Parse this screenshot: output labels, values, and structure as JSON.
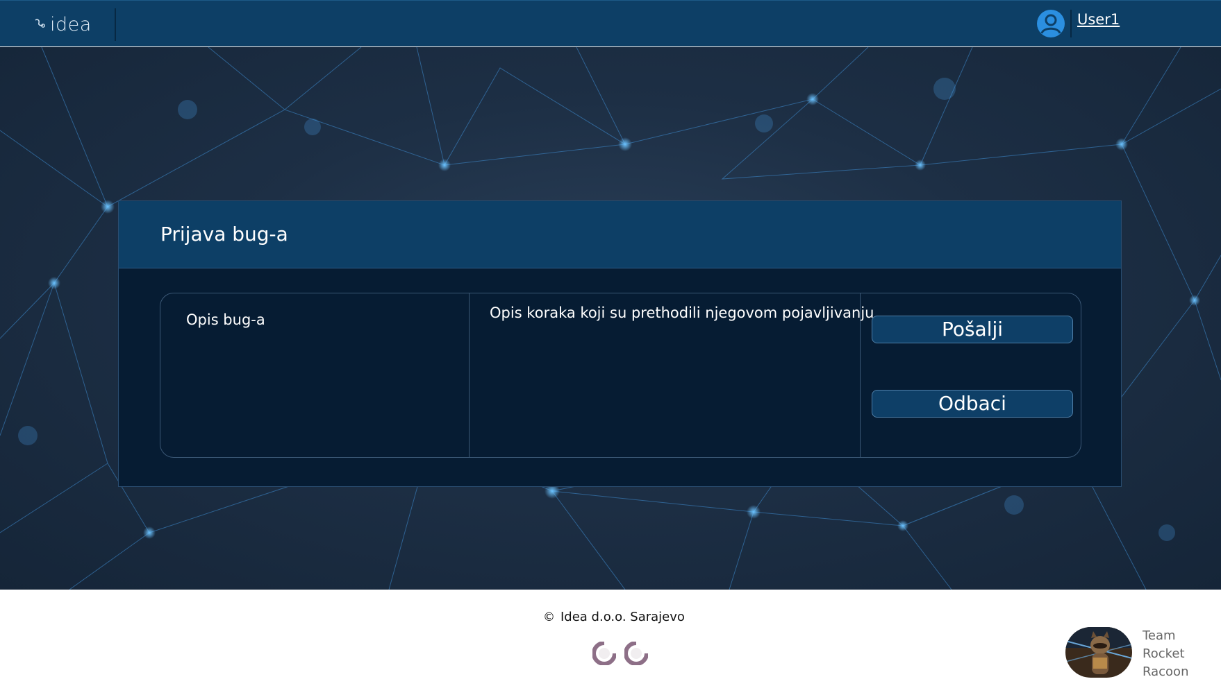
{
  "header": {
    "logo_text": "idea",
    "user_name": "User1"
  },
  "panel": {
    "title": "Prijava bug-a",
    "bug_description_label": "Opis bug-a",
    "steps_label": "Opis koraka koji su prethodili njegovom pojavljivanju",
    "send_button": "Pošalji",
    "discard_button": "Odbaci"
  },
  "footer": {
    "copyright_symbol": "©",
    "copyright_text": "Idea d.o.o. Sarajevo",
    "team_lines": [
      "Team",
      "Rocket",
      "Racoon"
    ]
  },
  "colors": {
    "header_bg": "#0d3f66",
    "panel_bg": "#061c33",
    "button_bg": "#0e3f67",
    "accent": "#3d9be9"
  },
  "icons": {
    "logo": "idea-logo-icon",
    "user": "user-avatar-icon",
    "badges": [
      "badge-icon",
      "badge-icon"
    ],
    "team": "raccoon-avatar-icon"
  }
}
